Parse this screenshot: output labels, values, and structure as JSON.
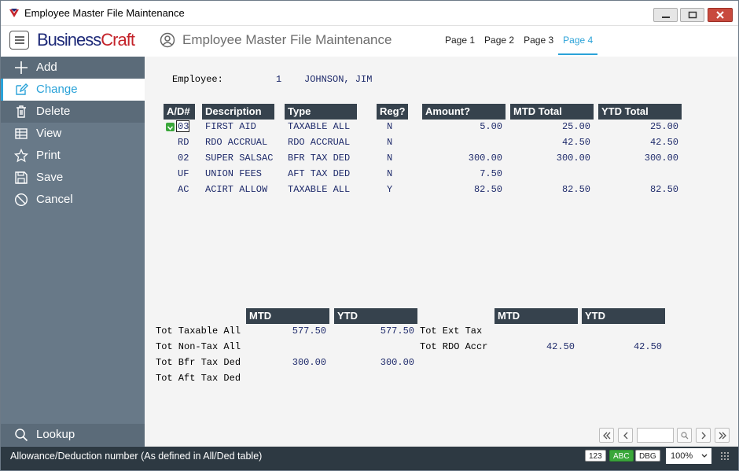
{
  "window": {
    "title": "Employee Master File Maintenance"
  },
  "header": {
    "logo_part1": "Business",
    "logo_part2": "Craft",
    "page_title": "Employee Master File Maintenance",
    "tabs": [
      {
        "label": "Page 1",
        "active": false
      },
      {
        "label": "Page 2",
        "active": false
      },
      {
        "label": "Page 3",
        "active": false
      },
      {
        "label": "Page 4",
        "active": true
      }
    ]
  },
  "sidebar": {
    "items": [
      {
        "label": "Add",
        "icon": "plus-icon"
      },
      {
        "label": "Change",
        "icon": "edit-icon",
        "active": true
      },
      {
        "label": "Delete",
        "icon": "trash-icon"
      },
      {
        "label": "View",
        "icon": "table-icon"
      },
      {
        "label": "Print",
        "icon": "star-icon"
      },
      {
        "label": "Save",
        "icon": "save-icon"
      },
      {
        "label": "Cancel",
        "icon": "cancel-icon"
      }
    ],
    "lookup_label": "Lookup"
  },
  "employee": {
    "label": "Employee:",
    "number": "1",
    "name": "JOHNSON, JIM"
  },
  "table": {
    "headers": {
      "ad": "A/D#",
      "description": "Description",
      "type": "Type",
      "reg": "Reg?",
      "amount": "Amount?",
      "mtd": "MTD Total",
      "ytd": "YTD Total"
    },
    "rows": [
      {
        "ad": "03",
        "description": "FIRST AID",
        "type": "TAXABLE ALL",
        "reg": "N",
        "amount": "5.00",
        "mtd": "25.00",
        "ytd": "25.00"
      },
      {
        "ad": "RD",
        "description": "RDO ACCRUAL",
        "type": "RDO ACCRUAL",
        "reg": "N",
        "amount": "",
        "mtd": "42.50",
        "ytd": "42.50"
      },
      {
        "ad": "02",
        "description": "SUPER SALSAC",
        "type": "BFR TAX DED",
        "reg": "N",
        "amount": "300.00",
        "mtd": "300.00",
        "ytd": "300.00"
      },
      {
        "ad": "UF",
        "description": "UNION FEES",
        "type": "AFT TAX DED",
        "reg": "N",
        "amount": "7.50",
        "mtd": "",
        "ytd": ""
      },
      {
        "ad": "AC",
        "description": "ACIRT ALLOW",
        "type": "TAXABLE ALL",
        "reg": "Y",
        "amount": "82.50",
        "mtd": "82.50",
        "ytd": "82.50"
      }
    ]
  },
  "totals_left": {
    "mtd_header": "MTD",
    "ytd_header": "YTD",
    "rows": [
      {
        "label": "Tot Taxable All",
        "mtd": "577.50",
        "ytd": "577.50"
      },
      {
        "label": "Tot Non-Tax All",
        "mtd": "",
        "ytd": ""
      },
      {
        "label": "Tot Bfr Tax Ded",
        "mtd": "300.00",
        "ytd": "300.00"
      },
      {
        "label": "Tot Aft Tax Ded",
        "mtd": "",
        "ytd": ""
      }
    ]
  },
  "totals_right": {
    "mtd_header": "MTD",
    "ytd_header": "YTD",
    "rows": [
      {
        "label": "Tot Ext Tax",
        "mtd": "",
        "ytd": ""
      },
      {
        "label": "Tot RDO Accr",
        "mtd": "42.50",
        "ytd": "42.50"
      }
    ]
  },
  "statusbar": {
    "message": "Allowance/Deduction number (As defined in All/Ded table)",
    "badge_123": "123",
    "badge_abc": "ABC",
    "badge_dbg": "DBG",
    "zoom": "100%"
  },
  "colors": {
    "sidebar_bg": "#687988",
    "accent": "#2aa2d8",
    "header_bg": "#36424d",
    "statusbar_bg": "#2d3942",
    "mono_text": "#1f2b6b"
  }
}
